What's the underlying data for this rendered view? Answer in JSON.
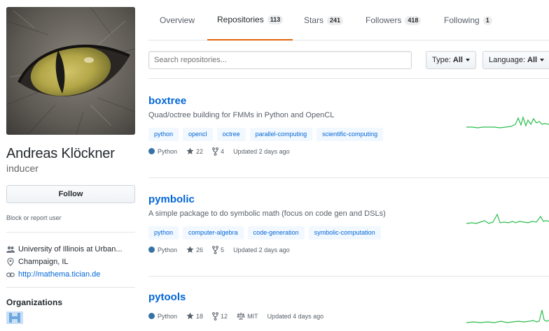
{
  "profile": {
    "fullname": "Andreas Klöckner",
    "username": "inducer",
    "follow_label": "Follow",
    "block_label": "Block or report user",
    "details": [
      {
        "icon": "people-icon",
        "text": "University of Illinois at Urban...",
        "link": false
      },
      {
        "icon": "location-icon",
        "text": "Champaign, IL",
        "link": false
      },
      {
        "icon": "link-icon",
        "text": "http://mathema.tician.de",
        "link": true
      }
    ],
    "organizations_title": "Organizations"
  },
  "tabs": [
    {
      "label": "Overview",
      "count": ""
    },
    {
      "label": "Repositories",
      "count": "113"
    },
    {
      "label": "Stars",
      "count": "241"
    },
    {
      "label": "Followers",
      "count": "418"
    },
    {
      "label": "Following",
      "count": "1"
    }
  ],
  "filters": {
    "search_placeholder": "Search repositories...",
    "type_label": "Type:",
    "type_value": "All",
    "language_label": "Language:",
    "language_value": "All"
  },
  "repos": [
    {
      "name": "boxtree",
      "description": "Quad/octree building for FMMs in Python and OpenCL",
      "topics": [
        "python",
        "opencl",
        "octree",
        "parallel-computing",
        "scientific-computing"
      ],
      "language": "Python",
      "stars": "22",
      "forks": "4",
      "license": "",
      "updated": "Updated 2 days ago"
    },
    {
      "name": "pymbolic",
      "description": "A simple package to do symbolic math (focus on code gen and DSLs)",
      "topics": [
        "python",
        "computer-algebra",
        "code-generation",
        "symbolic-computation"
      ],
      "language": "Python",
      "stars": "26",
      "forks": "5",
      "license": "",
      "updated": "Updated 2 days ago"
    },
    {
      "name": "pytools",
      "description": "",
      "topics": [],
      "language": "Python",
      "stars": "18",
      "forks": "12",
      "license": "MIT",
      "updated": "Updated 4 days ago"
    }
  ],
  "colors": {
    "link": "#0366d6",
    "tab_underline": "#e36209",
    "python": "#3572A5",
    "spark": "#2cbe4e"
  }
}
